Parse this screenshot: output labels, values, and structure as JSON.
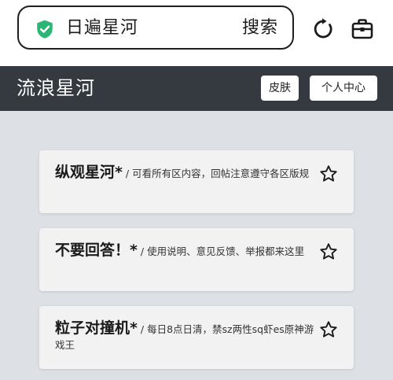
{
  "search": {
    "text": "日遍星河",
    "button_label": "搜索"
  },
  "header": {
    "title": "流浪星河",
    "skin_label": "皮肤",
    "user_center_label": "个人中心"
  },
  "boards": [
    {
      "name": "纵观星河*",
      "description": " / 可看所有区内容，回帖注意遵守各区版规"
    },
    {
      "name": "不要回答！*",
      "description": " / 使用说明、意见反馈、举报都来这里"
    },
    {
      "name": "粒子对撞机*",
      "description": " / 每日8点日清，禁sz两性sq虾es原神游戏王"
    }
  ],
  "icons": {
    "secure": "shield-check-icon",
    "reload": "reload-icon",
    "toolbox": "toolbox-icon",
    "favorite": "star-outline-icon"
  },
  "colors": {
    "header_bg": "#353a40",
    "page_bg": "#dde0e5",
    "secure_green": "#2bb673"
  }
}
